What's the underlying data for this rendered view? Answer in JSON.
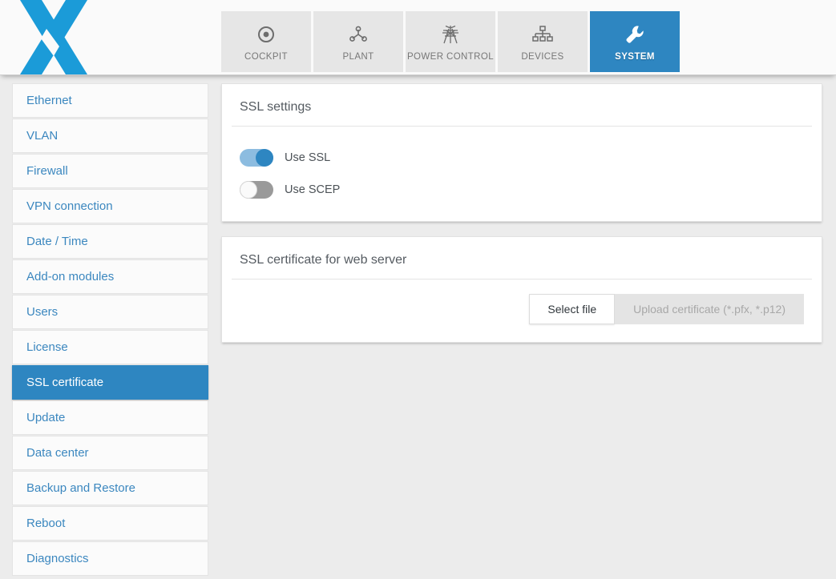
{
  "header": {
    "logo_name": "x-logo",
    "tabs": [
      {
        "label": "COCKPIT",
        "icon": "target-icon",
        "active": false
      },
      {
        "label": "PLANT",
        "icon": "share-nodes-icon",
        "active": false
      },
      {
        "label": "POWER CONTROL",
        "icon": "power-tower-icon",
        "active": false
      },
      {
        "label": "DEVICES",
        "icon": "sitemap-icon",
        "active": false
      },
      {
        "label": "SYSTEM",
        "icon": "wrench-icon",
        "active": true
      }
    ]
  },
  "sidebar": {
    "items": [
      {
        "label": "Ethernet",
        "active": false
      },
      {
        "label": "VLAN",
        "active": false
      },
      {
        "label": "Firewall",
        "active": false
      },
      {
        "label": "VPN connection",
        "active": false
      },
      {
        "label": "Date / Time",
        "active": false
      },
      {
        "label": "Add-on modules",
        "active": false
      },
      {
        "label": "Users",
        "active": false
      },
      {
        "label": "License",
        "active": false
      },
      {
        "label": "SSL certificate",
        "active": true
      },
      {
        "label": "Update",
        "active": false
      },
      {
        "label": "Data center",
        "active": false
      },
      {
        "label": "Backup and Restore",
        "active": false
      },
      {
        "label": "Reboot",
        "active": false
      },
      {
        "label": "Diagnostics",
        "active": false
      }
    ]
  },
  "main": {
    "ssl_settings": {
      "title": "SSL settings",
      "toggles": [
        {
          "label": "Use SSL",
          "state": "on"
        },
        {
          "label": "Use SCEP",
          "state": "off"
        }
      ]
    },
    "ssl_certificate": {
      "title": "SSL certificate for web server",
      "select_file_label": "Select file",
      "upload_label": "Upload certificate (*.pfx, *.p12)",
      "upload_disabled": true
    }
  },
  "colors": {
    "accent_blue": "#2e86c1",
    "logo_blue": "#1b9bd8",
    "link_blue": "#3b87bf",
    "page_bg": "#ececec",
    "tab_bg": "#e6e6e6"
  }
}
